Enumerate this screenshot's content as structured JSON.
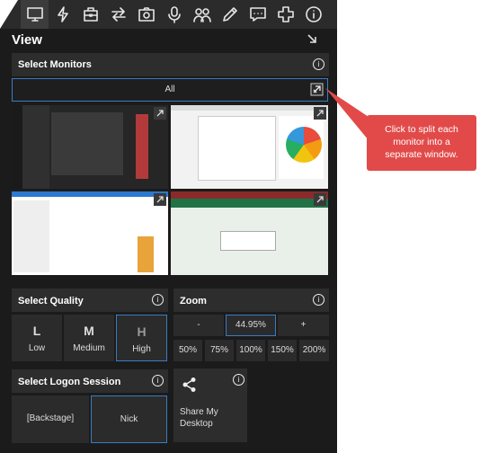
{
  "toolbar": {
    "icons": [
      "monitor-icon",
      "lightning-icon",
      "toolbox-icon",
      "transfer-arrows-icon",
      "camera-icon",
      "microphone-icon",
      "users-icon",
      "pencil-icon",
      "chat-icon",
      "plus-cross-icon",
      "info-icon"
    ],
    "active": "monitor-icon"
  },
  "view": {
    "title": "View"
  },
  "monitors": {
    "title": "Select Monitors",
    "all_label": "All",
    "thumbnails": [
      "monitor-1",
      "monitor-2",
      "monitor-3",
      "monitor-4"
    ]
  },
  "quality": {
    "title": "Select Quality",
    "options": [
      {
        "letter": "L",
        "label": "Low",
        "selected": false
      },
      {
        "letter": "M",
        "label": "Medium",
        "selected": false
      },
      {
        "letter": "H",
        "label": "High",
        "selected": true
      }
    ]
  },
  "zoom": {
    "title": "Zoom",
    "minus": "-",
    "value": "44.95%",
    "plus": "+",
    "presets": [
      "50%",
      "75%",
      "100%",
      "150%",
      "200%"
    ]
  },
  "logon": {
    "title": "Select Logon Session",
    "sessions": [
      {
        "label": "[Backstage]",
        "selected": false
      },
      {
        "label": "Nick",
        "selected": true
      }
    ]
  },
  "share": {
    "label_line1": "Share My",
    "label_line2": "Desktop"
  },
  "callout": {
    "line1": "Click to split each",
    "line2": "monitor into a",
    "line3": "separate window."
  },
  "colors": {
    "panel": "#1b1b1b",
    "section": "#2d2d2d",
    "accent": "#3a7cc4",
    "callout": "#e24a4a"
  }
}
